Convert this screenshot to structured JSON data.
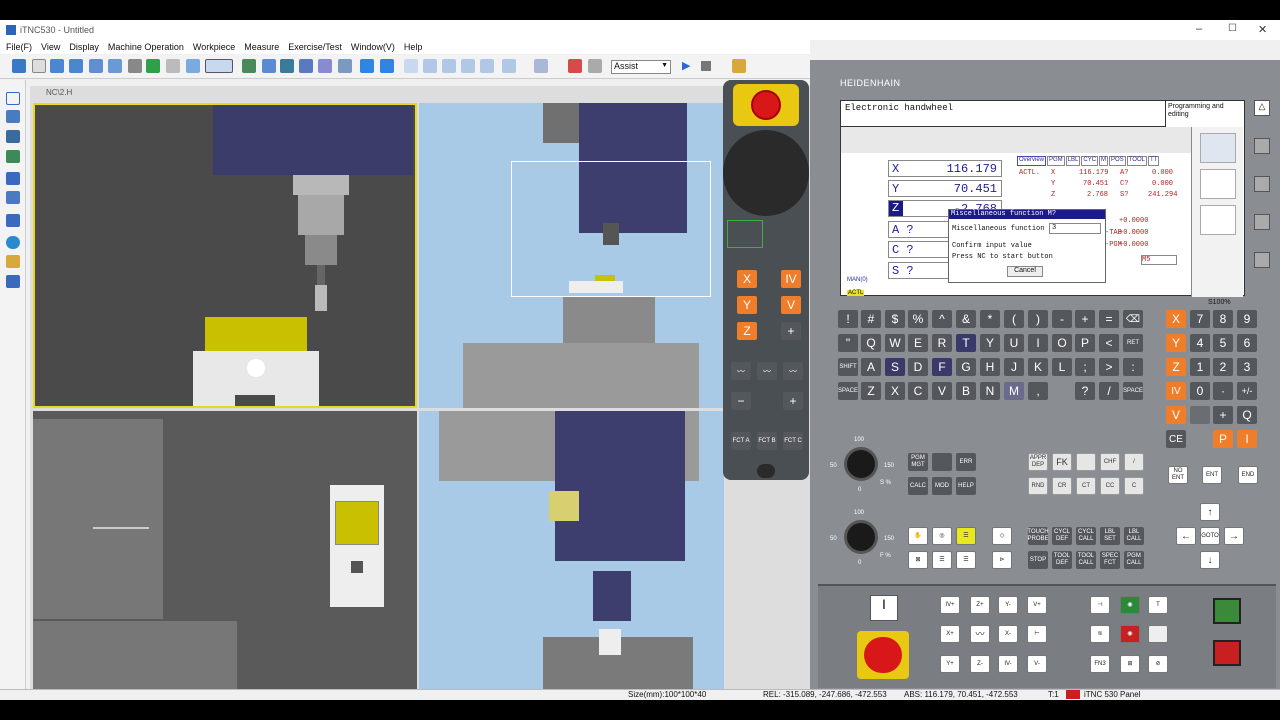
{
  "window": {
    "title": "iTNC530 - Untitled"
  },
  "menu": [
    "File(F)",
    "View",
    "Display",
    "Machine Operation",
    "Workpiece",
    "Measure",
    "Exercise/Test",
    "Window(V)",
    "Help"
  ],
  "toolbar": {
    "mode_select": "Assist"
  },
  "viewport": {
    "label": "NC\\2.H"
  },
  "status": {
    "size": "Size(mm):100*100*40",
    "rel": "REL: -315.089, -247.686, -472.553",
    "abs": "ABS: 116.179, 70.451, -472.553",
    "tool": "T:1",
    "panel": "iTNC 530 Panel"
  },
  "control": {
    "brand": "HEIDENHAIN",
    "screen_title": "Electronic handwheel",
    "mode_right": "Programming and editing",
    "axes": [
      {
        "name": "X",
        "value": "116.179"
      },
      {
        "name": "Y",
        "value": "70.451"
      },
      {
        "name": "Z",
        "value": "-2.768"
      },
      {
        "name": "A ?",
        "value": ""
      },
      {
        "name": "C ?",
        "value": ""
      },
      {
        "name": "S ?",
        "value": ""
      }
    ],
    "tabs": [
      "Overview",
      "PGM",
      "LBL",
      "CYC",
      "M",
      "POS",
      "TOOL",
      "TT"
    ],
    "status_rows": [
      {
        "a": "ACTL.",
        "b": "X",
        "c": "116.179",
        "d": "A?",
        "e": "0.000"
      },
      {
        "a": "",
        "b": "Y",
        "c": "70.451",
        "d": "C?",
        "e": "0.000"
      },
      {
        "a": "",
        "b": "Z",
        "c": "2.768",
        "d": "S?",
        "e": "241.294"
      }
    ],
    "extra_vals": [
      "+0.0000",
      "+0.0000",
      "+0.0000"
    ],
    "side_labels": [
      "-TAB",
      "-PGM"
    ],
    "m_field": "M5",
    "s_percent": "S100%",
    "dialog": {
      "title": "Miscellaneous  function M?",
      "field_label": "Miscellaneous  function",
      "field_value": "3",
      "line1": "Confirm input value",
      "line2": "Press NC to start button",
      "cancel": "Cancel"
    },
    "bottom_labels": {
      "mk": "MAN(0)",
      "actl": "ACTL"
    }
  },
  "keyboard": {
    "row1": [
      "!",
      "#",
      "$",
      "%",
      "^",
      "&",
      "*",
      "(",
      ")",
      "-",
      "+",
      "="
    ],
    "row2": [
      "\"",
      "Q",
      "W",
      "E",
      "R",
      "T",
      "Y",
      "U",
      "I",
      "O",
      "P",
      "<"
    ],
    "row3": [
      "A",
      "S",
      "D",
      "F",
      "G",
      "H",
      "J",
      "K",
      "L",
      ";",
      ">",
      ":"
    ],
    "row4": [
      "Z",
      "X",
      "C",
      "V",
      "B",
      "N",
      "M",
      ",",
      "?",
      "/"
    ],
    "specials": {
      "ret": "RET",
      "shift": "SHIFT",
      "space": "SPACE"
    }
  },
  "numpad": {
    "rows": [
      [
        "X",
        "7",
        "8",
        "9"
      ],
      [
        "Y",
        "4",
        "5",
        "6"
      ],
      [
        "Z",
        "1",
        "2",
        "3"
      ],
      [
        "IV",
        "0",
        "·",
        "+/-"
      ],
      [
        "V",
        "",
        "+",
        "Q"
      ],
      [
        "CE",
        "",
        "P",
        "I"
      ]
    ]
  },
  "handwheel": {
    "axes": [
      "X",
      "Y",
      "Z"
    ],
    "axes2": [
      "IV",
      "V",
      "+"
    ],
    "fct": [
      "FCT A",
      "FCT B",
      "FCT C"
    ]
  },
  "override": {
    "spindle_label": "S %",
    "feed_label": "F %",
    "scale": [
      "0",
      "50",
      "100",
      "150"
    ]
  },
  "function_keys": {
    "pgm": "PGM MGT",
    "err": "ERR",
    "calc": "CALC",
    "mod": "MOD",
    "help": "HELP",
    "fk": "FK",
    "no_ent": "NO ENT",
    "ent": "ENT",
    "end": "END",
    "goto": "GOTO"
  },
  "cycle_keys": [
    "TOUCH PROBE",
    "CYCL DEF",
    "CYCL CALL",
    "LBL SET",
    "LBL CALL",
    "STOP",
    "TOOL DEF",
    "TOOL CALL",
    "SPEC FCT",
    "PGM CALL"
  ],
  "jog_keys": [
    [
      "IV+",
      "Z+",
      "Y-",
      "V+"
    ],
    [
      "X+",
      "",
      "X-",
      ""
    ],
    [
      "Y+",
      "Z-",
      "IV-",
      "V-"
    ]
  ]
}
